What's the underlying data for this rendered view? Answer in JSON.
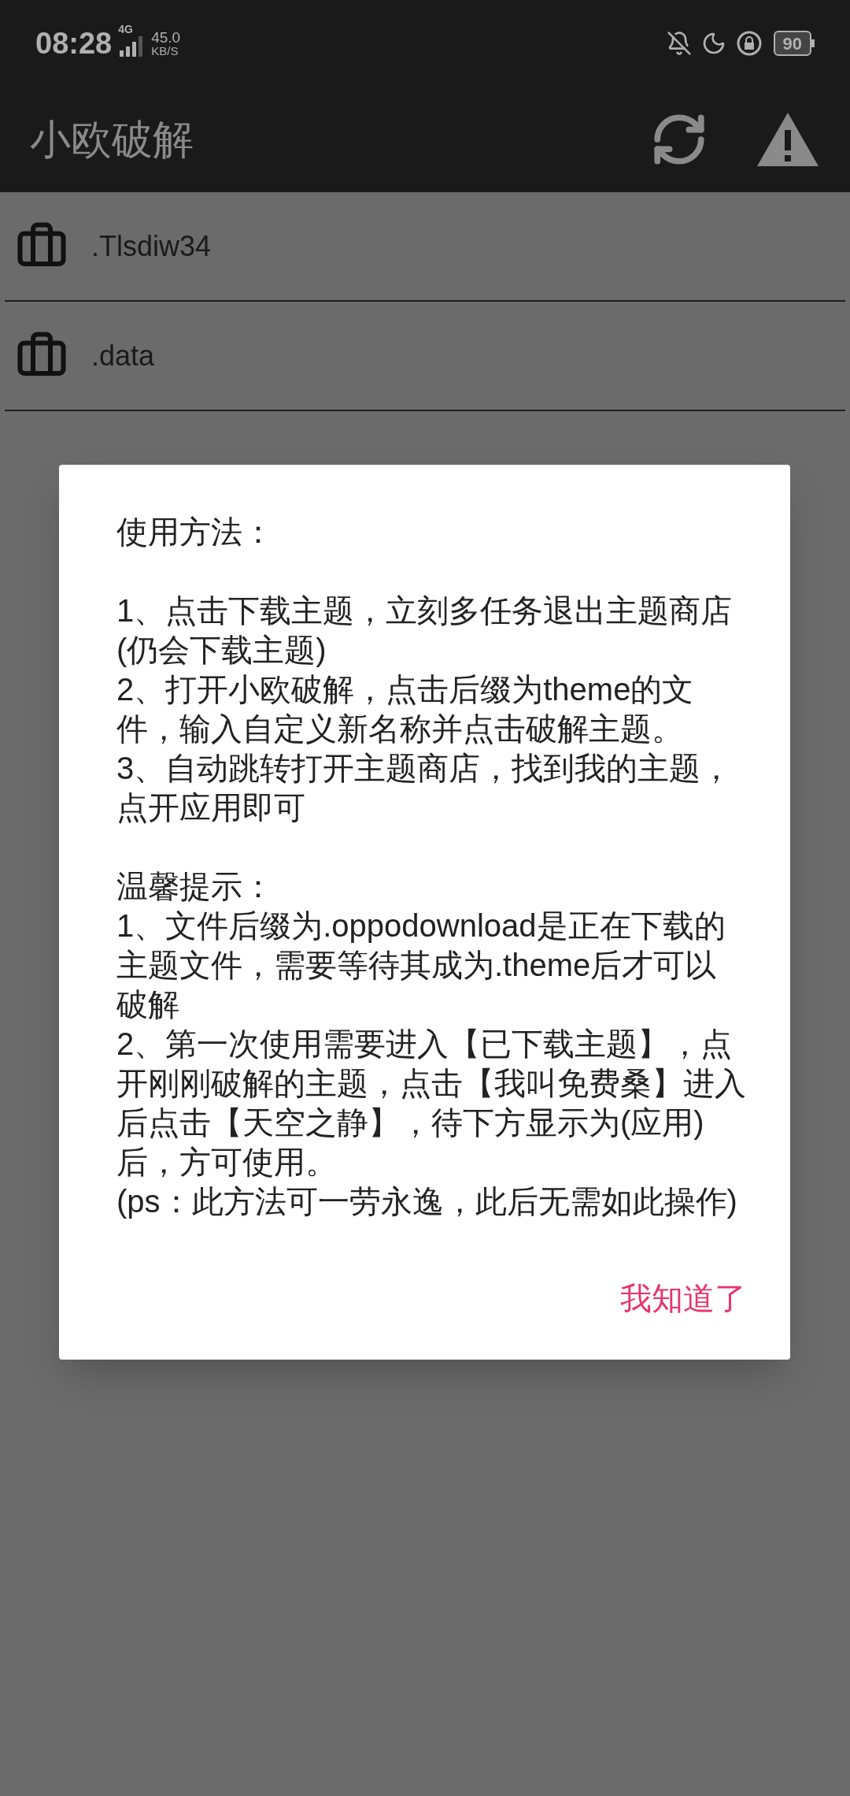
{
  "status_bar": {
    "time": "08:28",
    "network": "4G",
    "speed": "45.0",
    "speed_unit": "KB/S",
    "battery": "90"
  },
  "app_bar": {
    "title": "小欧破解"
  },
  "files": [
    {
      "name": ".Tlsdiw34"
    },
    {
      "name": ".data"
    }
  ],
  "dialog": {
    "sections": [
      {
        "heading": "使用方法：",
        "items": [
          "1、点击下载主题，立刻多任务退出主题商店(仍会下载主题)",
          "2、打开小欧破解，点击后缀为theme的文件，输入自定义新名称并点击破解主题。",
          "3、自动跳转打开主题商店，找到我的主题，点开应用即可"
        ]
      },
      {
        "heading": "温馨提示：",
        "items": [
          "1、文件后缀为.oppodownload是正在下载的主题文件，需要等待其成为.theme后才可以破解",
          "2、第一次使用需要进入【已下载主题】，点开刚刚破解的主题，点击【我叫免费桑】进入后点击【天空之静】，待下方显示为(应用)后，方可使用。",
          "(ps：此方法可一劳永逸，此后无需如此操作)"
        ]
      }
    ],
    "button": "我知道了"
  }
}
